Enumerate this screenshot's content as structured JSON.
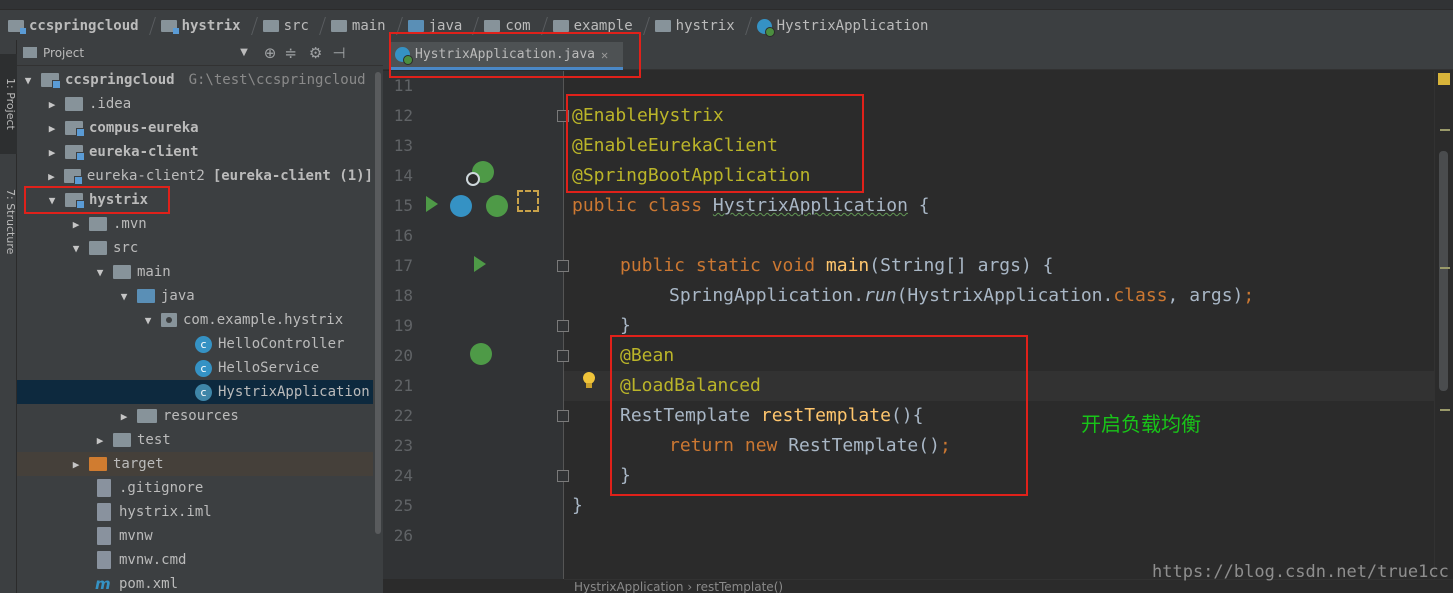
{
  "breadcrumb": [
    {
      "label": "ccspringcloud",
      "icon": "module-folder-icon",
      "bold": true
    },
    {
      "label": "hystrix",
      "icon": "module-folder-icon",
      "bold": true
    },
    {
      "label": "src",
      "icon": "folder-icon"
    },
    {
      "label": "main",
      "icon": "folder-icon"
    },
    {
      "label": "java",
      "icon": "source-folder-icon"
    },
    {
      "label": "com",
      "icon": "package-icon"
    },
    {
      "label": "example",
      "icon": "package-icon"
    },
    {
      "label": "hystrix",
      "icon": "package-icon"
    },
    {
      "label": "HystrixApplication",
      "icon": "spring-boot-class-icon"
    }
  ],
  "tool_windows": {
    "project_tab": "1: Project",
    "structure_tab": "7: Structure"
  },
  "project_panel": {
    "title": "Project",
    "tree": [
      {
        "label": "ccspringcloud",
        "path": "G:\\test\\ccspringcloud",
        "expanded": true,
        "type": "module",
        "bold": true
      },
      {
        "label": ".idea",
        "type": "folder",
        "expanded": false
      },
      {
        "label": "compus-eureka",
        "type": "module",
        "bold": true,
        "expanded": false
      },
      {
        "label": "eureka-client",
        "type": "module",
        "bold": true,
        "expanded": false
      },
      {
        "label": "eureka-client2",
        "suffix": "[eureka-client (1)]",
        "type": "module",
        "expanded": false
      },
      {
        "label": "hystrix",
        "type": "module",
        "bold": true,
        "expanded": true
      },
      {
        "label": ".mvn",
        "type": "folder",
        "expanded": false
      },
      {
        "label": "src",
        "type": "folder",
        "expanded": true
      },
      {
        "label": "main",
        "type": "folder",
        "expanded": true
      },
      {
        "label": "java",
        "type": "source-folder",
        "expanded": true
      },
      {
        "label": "com.example.hystrix",
        "type": "package",
        "expanded": true
      },
      {
        "label": "HelloController",
        "type": "class"
      },
      {
        "label": "HelloService",
        "type": "class"
      },
      {
        "label": "HystrixApplication",
        "type": "spring-boot-class",
        "selected": true
      },
      {
        "label": "resources",
        "type": "resources-folder",
        "expanded": false
      },
      {
        "label": "test",
        "type": "folder",
        "expanded": false
      },
      {
        "label": "target",
        "type": "excluded-folder",
        "expanded": false
      },
      {
        "label": ".gitignore",
        "type": "file"
      },
      {
        "label": "hystrix.iml",
        "type": "file"
      },
      {
        "label": "mvnw",
        "type": "file"
      },
      {
        "label": "mvnw.cmd",
        "type": "file"
      },
      {
        "label": "pom.xml",
        "type": "maven-file"
      }
    ]
  },
  "editor": {
    "tab_label": "HystrixApplication.java",
    "line_numbers": [
      "11",
      "12",
      "13",
      "14",
      "15",
      "16",
      "17",
      "18",
      "19",
      "20",
      "21",
      "22",
      "23",
      "24",
      "25",
      "26"
    ],
    "code": {
      "l12": "@EnableHystrix",
      "l13": "@EnableEurekaClient",
      "l14": "@SpringBootApplication",
      "l15_kw": "public class ",
      "l15_cls": "HystrixApplication",
      "l15_rest": " {",
      "l17_kw": "public static void ",
      "l17_fn": "main",
      "l17_rest": "(String[] args) {",
      "l18_a": "SpringApplication.",
      "l18_run": "run",
      "l18_b": "(HystrixApplication.",
      "l18_class": "class",
      "l18_c": ", args)",
      "l18_semi": ";",
      "l19": "}",
      "l20": "@Bean",
      "l21": "@LoadBalanced",
      "l22_type": "RestTemplate ",
      "l22_fn": "restTemplate",
      "l22_rest": "(){",
      "l23_kw": "return new ",
      "l23_rest": "RestTemplate()",
      "l23_semi": ";",
      "l24": "}",
      "l25": "}"
    },
    "annotation_note": "开启负载均衡",
    "bottom_breadcrumb": "HystrixApplication  ›  restTemplate()"
  },
  "watermark": "https://blog.csdn.net/true1cc",
  "colors": {
    "highlight_box": "#e0211a",
    "note_text": "#18c418",
    "annotation": "#bbb529",
    "keyword": "#cc7832",
    "method": "#ffc66d",
    "selection": "#0d293e"
  }
}
